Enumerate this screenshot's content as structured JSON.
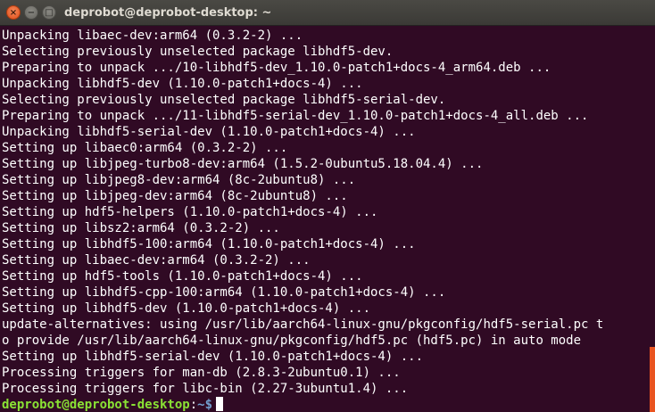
{
  "window": {
    "title": "deprobot@deprobot-desktop: ~",
    "close_glyph": "×",
    "minimize_glyph": "−",
    "maximize_glyph": "□"
  },
  "terminal": {
    "lines": [
      "Unpacking libaec-dev:arm64 (0.3.2-2) ...",
      "Selecting previously unselected package libhdf5-dev.",
      "Preparing to unpack .../10-libhdf5-dev_1.10.0-patch1+docs-4_arm64.deb ...",
      "Unpacking libhdf5-dev (1.10.0-patch1+docs-4) ...",
      "Selecting previously unselected package libhdf5-serial-dev.",
      "Preparing to unpack .../11-libhdf5-serial-dev_1.10.0-patch1+docs-4_all.deb ...",
      "Unpacking libhdf5-serial-dev (1.10.0-patch1+docs-4) ...",
      "Setting up libaec0:arm64 (0.3.2-2) ...",
      "Setting up libjpeg-turbo8-dev:arm64 (1.5.2-0ubuntu5.18.04.4) ...",
      "Setting up libjpeg8-dev:arm64 (8c-2ubuntu8) ...",
      "Setting up libjpeg-dev:arm64 (8c-2ubuntu8) ...",
      "Setting up hdf5-helpers (1.10.0-patch1+docs-4) ...",
      "Setting up libsz2:arm64 (0.3.2-2) ...",
      "Setting up libhdf5-100:arm64 (1.10.0-patch1+docs-4) ...",
      "Setting up libaec-dev:arm64 (0.3.2-2) ...",
      "Setting up hdf5-tools (1.10.0-patch1+docs-4) ...",
      "Setting up libhdf5-cpp-100:arm64 (1.10.0-patch1+docs-4) ...",
      "Setting up libhdf5-dev (1.10.0-patch1+docs-4) ...",
      "update-alternatives: using /usr/lib/aarch64-linux-gnu/pkgconfig/hdf5-serial.pc t",
      "o provide /usr/lib/aarch64-linux-gnu/pkgconfig/hdf5.pc (hdf5.pc) in auto mode",
      "Setting up libhdf5-serial-dev (1.10.0-patch1+docs-4) ...",
      "Processing triggers for man-db (2.8.3-2ubuntu0.1) ...",
      "Processing triggers for libc-bin (2.27-3ubuntu1.4) ..."
    ],
    "prompt": {
      "user_host": "deprobot@deprobot-desktop",
      "separator": ":",
      "path": "~$"
    }
  },
  "colors": {
    "background": "#300a24",
    "text": "#ffffff",
    "prompt_user": "#8ae234",
    "prompt_path": "#729fcf",
    "scrollbar": "#e95420"
  }
}
